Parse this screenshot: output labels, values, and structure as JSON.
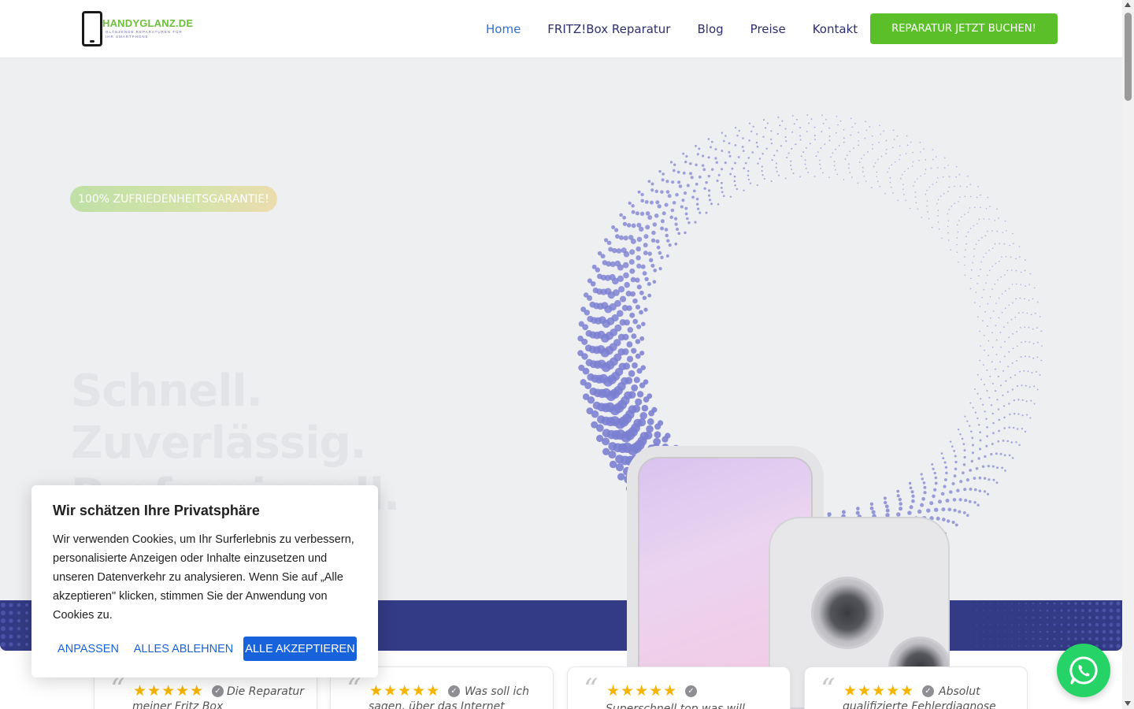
{
  "header": {
    "logo_text": "HANDYGLANZ.DE",
    "logo_tagline": "GLÄNZENDE REPARATUREN FÜR IHR SMARTPHONE",
    "nav": [
      {
        "label": "Home",
        "active": true
      },
      {
        "label": "FRITZ!Box Reparatur",
        "active": false
      },
      {
        "label": "Blog",
        "active": false
      },
      {
        "label": "Preise",
        "active": false
      },
      {
        "label": "Kontakt",
        "active": false
      }
    ],
    "cta_label": "REPARATUR JETZT BUCHEN!"
  },
  "hero": {
    "badge": "100% ZUFRIEDENHEITSGARANTIE!",
    "headline_1": "Schnell.",
    "headline_2": "Zuverlässig.",
    "headline_3": "Professionell."
  },
  "reviews": [
    {
      "text": "Die Reparatur meiner Fritz Box",
      "stars": 5
    },
    {
      "text": "Was soll ich sagen, über das Internet",
      "stars": 5
    },
    {
      "text": "Superschnell top was will",
      "stars": 5
    },
    {
      "text": "Absolut qualifizierte Fehlerdiagnose",
      "stars": 5
    }
  ],
  "cookie": {
    "title": "Wir schätzen Ihre Privatsphäre",
    "body": "Wir verwenden Cookies, um Ihr Surferlebnis zu verbessern, personalisierte Anzeigen oder Inhalte einzusetzen und unseren Datenverkehr zu analysieren. Wenn Sie auf „Alle akzeptieren\" klicken, stimmen Sie der Anwendung von Cookies zu.",
    "customize_label": "ANPASSEN",
    "reject_label": "ALLES ABLEHNEN",
    "accept_label": "ALLE AKZEPTIEREN"
  },
  "colors": {
    "brand_green": "#5bbf2a",
    "nav_text": "#2d2f6e",
    "nav_active": "#2f6fd6",
    "band_blue": "#343b86",
    "cookie_blue": "#1863dc",
    "star": "#f5b400",
    "whatsapp": "#25d366"
  },
  "icons": {
    "logo": "phone-icon",
    "whatsapp": "whatsapp-icon",
    "verified": "verified-check-icon",
    "quote": "quote-icon"
  }
}
